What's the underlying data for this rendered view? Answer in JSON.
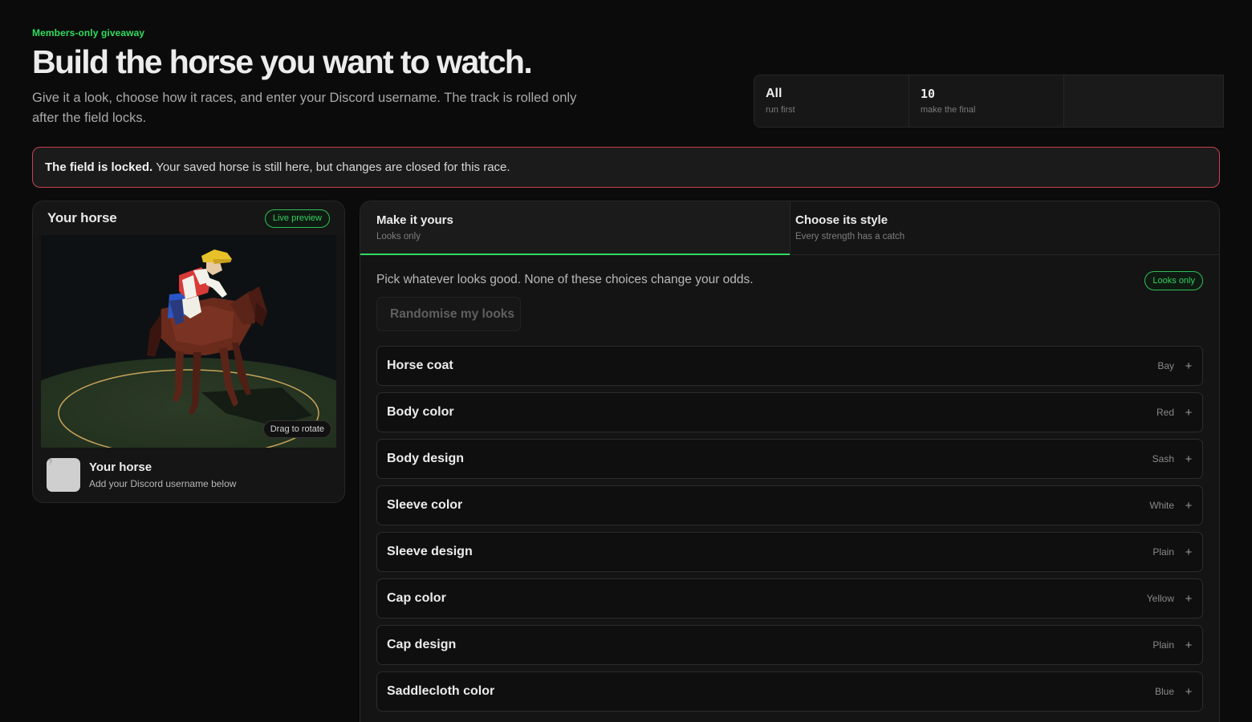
{
  "hero": {
    "eyebrow": "Members-only giveaway",
    "title": "Build the horse you want to watch.",
    "subtitle": "Give it a look, choose how it races, and enter your Discord username. The track is rolled only after the field locks."
  },
  "stats": [
    {
      "value": "All",
      "label": "run first"
    },
    {
      "value": "10",
      "label": "make the final"
    }
  ],
  "alert": {
    "strong": "The field is locked.",
    "text": "Your saved horse is still here, but changes are closed for this race."
  },
  "horse_card": {
    "title": "Your horse",
    "badge": "Live preview",
    "drag_hint": "Drag to rotate",
    "avatar_text": "?",
    "owner_name": "Your horse",
    "owner_hint": "Add your Discord username below"
  },
  "tabs": [
    {
      "title": "Make it yours",
      "subtitle": "Looks only"
    },
    {
      "title": "Choose its style",
      "subtitle": "Every strength has a catch"
    }
  ],
  "looks": {
    "intro": "Pick whatever looks good. None of these choices change your odds.",
    "badge": "Looks only",
    "randomise_label": "Randomise my looks",
    "options": [
      {
        "name": "Horse coat",
        "value": "Bay"
      },
      {
        "name": "Body color",
        "value": "Red"
      },
      {
        "name": "Body design",
        "value": "Sash"
      },
      {
        "name": "Sleeve color",
        "value": "White"
      },
      {
        "name": "Sleeve design",
        "value": "Plain"
      },
      {
        "name": "Cap color",
        "value": "Yellow"
      },
      {
        "name": "Cap design",
        "value": "Plain"
      },
      {
        "name": "Saddlecloth color",
        "value": "Blue"
      }
    ],
    "expand_symbol": "+"
  },
  "colors": {
    "accent_green": "#2fdc5f",
    "alert_border": "#c7424f",
    "background": "#0b0b0b"
  }
}
